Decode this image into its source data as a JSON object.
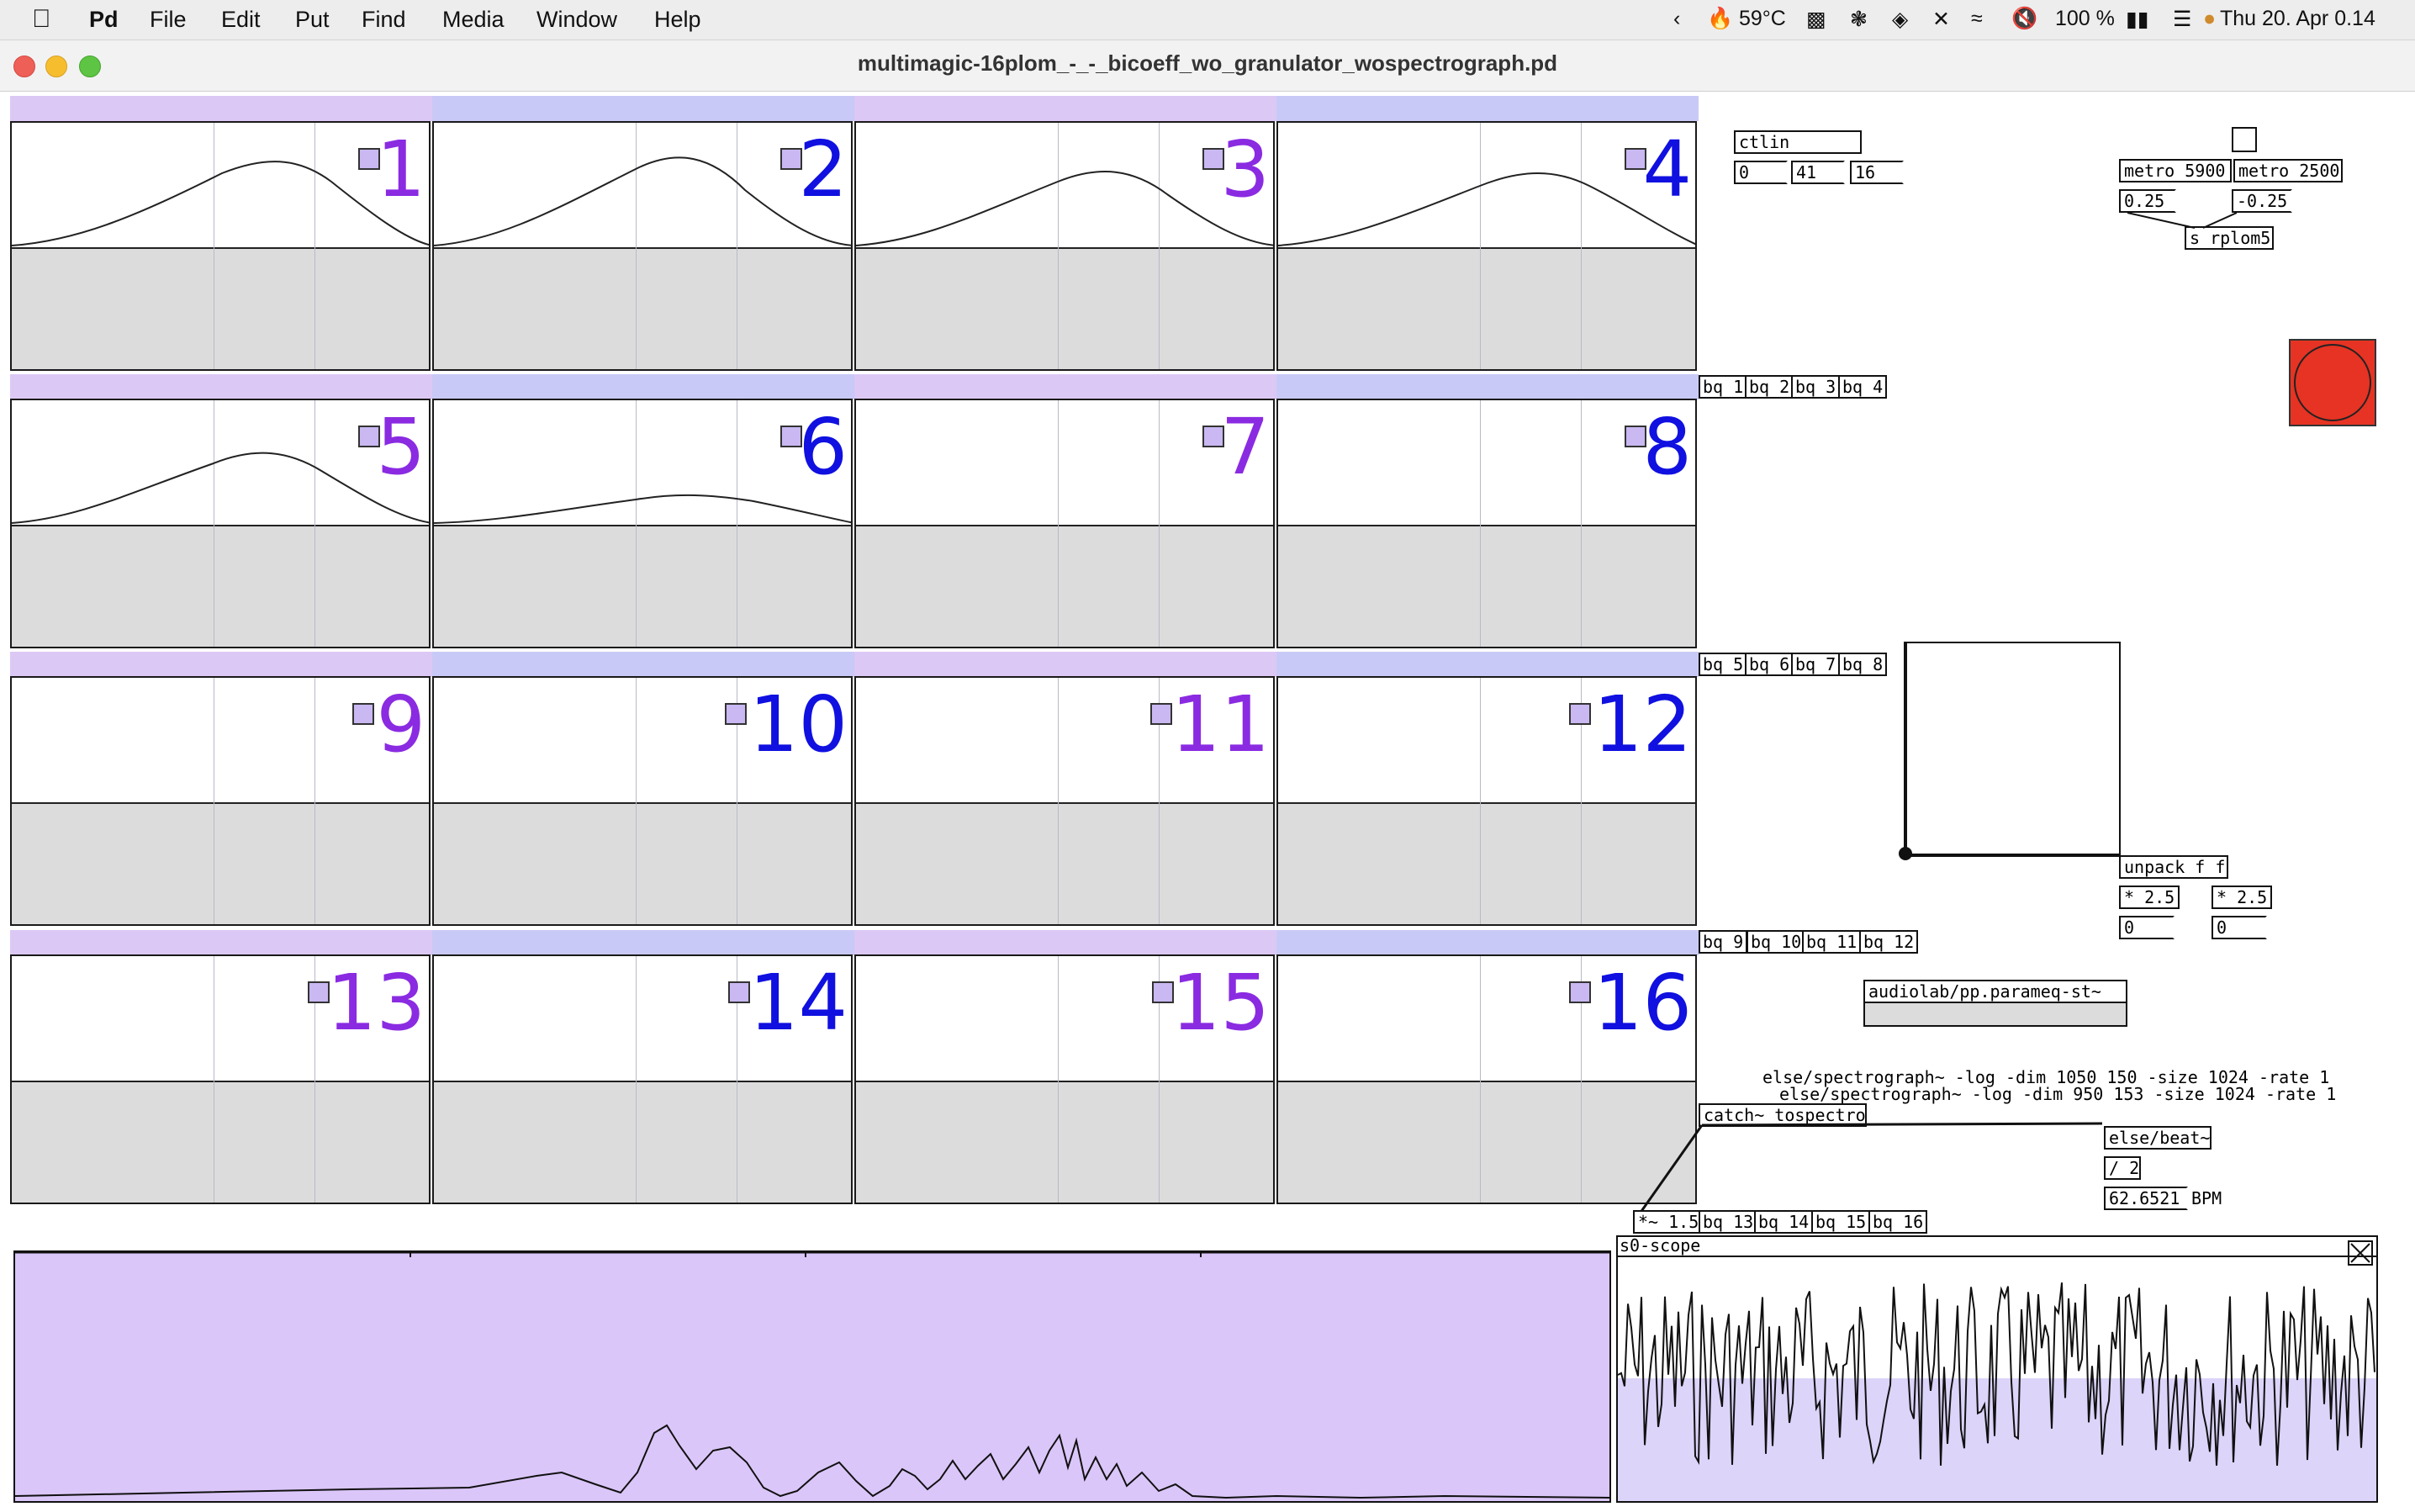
{
  "menubar": {
    "app": "Pd",
    "items": [
      "File",
      "Edit",
      "Put",
      "Find",
      "Media",
      "Window",
      "Help"
    ],
    "status": {
      "temp": "59°C",
      "battery": "100 %",
      "datetime": "Thu 20. Apr  0.14"
    }
  },
  "window": {
    "title": "multimagic-16plom_-_-_bicoeff_wo_granulator_wospectrograph.pd"
  },
  "grid": {
    "numbers": [
      "1",
      "2",
      "3",
      "4",
      "5",
      "6",
      "7",
      "8",
      "9",
      "10",
      "11",
      "12",
      "13",
      "14",
      "15",
      "16"
    ]
  },
  "bq_rows": [
    [
      "bq 1",
      "bq 2",
      "bq 3",
      "bq 4"
    ],
    [
      "bq 5",
      "bq 6",
      "bq 7",
      "bq 8"
    ],
    [
      "bq 9",
      "bq 10",
      "bq 11",
      "bq 12"
    ],
    [
      "bq 13",
      "bq 14",
      "bq 15",
      "bq 16"
    ]
  ],
  "objects": {
    "ctlin": "ctlin",
    "ctlin_nums": [
      "0",
      "41",
      "16"
    ],
    "metro1": "metro 5900",
    "metro2": "metro 2500",
    "msg1": "0.25",
    "msg2": "-0.25",
    "send": "s rplom5",
    "unpack": "unpack f f",
    "mul1": "* 2.5",
    "mul2": "* 2.5",
    "num1": "0",
    "num2": "0",
    "parameq": "audiolab/pp.parameq-st~",
    "spectro1": "else/spectrograph~ -log -dim 1050 150 -size 1024 -rate 1",
    "spectro2": "else/spectrograph~ -log -dim 950 153 -size 1024 -rate 1",
    "catch": "catch~ tospectro",
    "beat": "else/beat~",
    "div": "/ 2",
    "bpm_val": "62.6521",
    "bpm_label": "BPM",
    "mulsig": "*~ 1.5",
    "scope": "s0-scope"
  }
}
